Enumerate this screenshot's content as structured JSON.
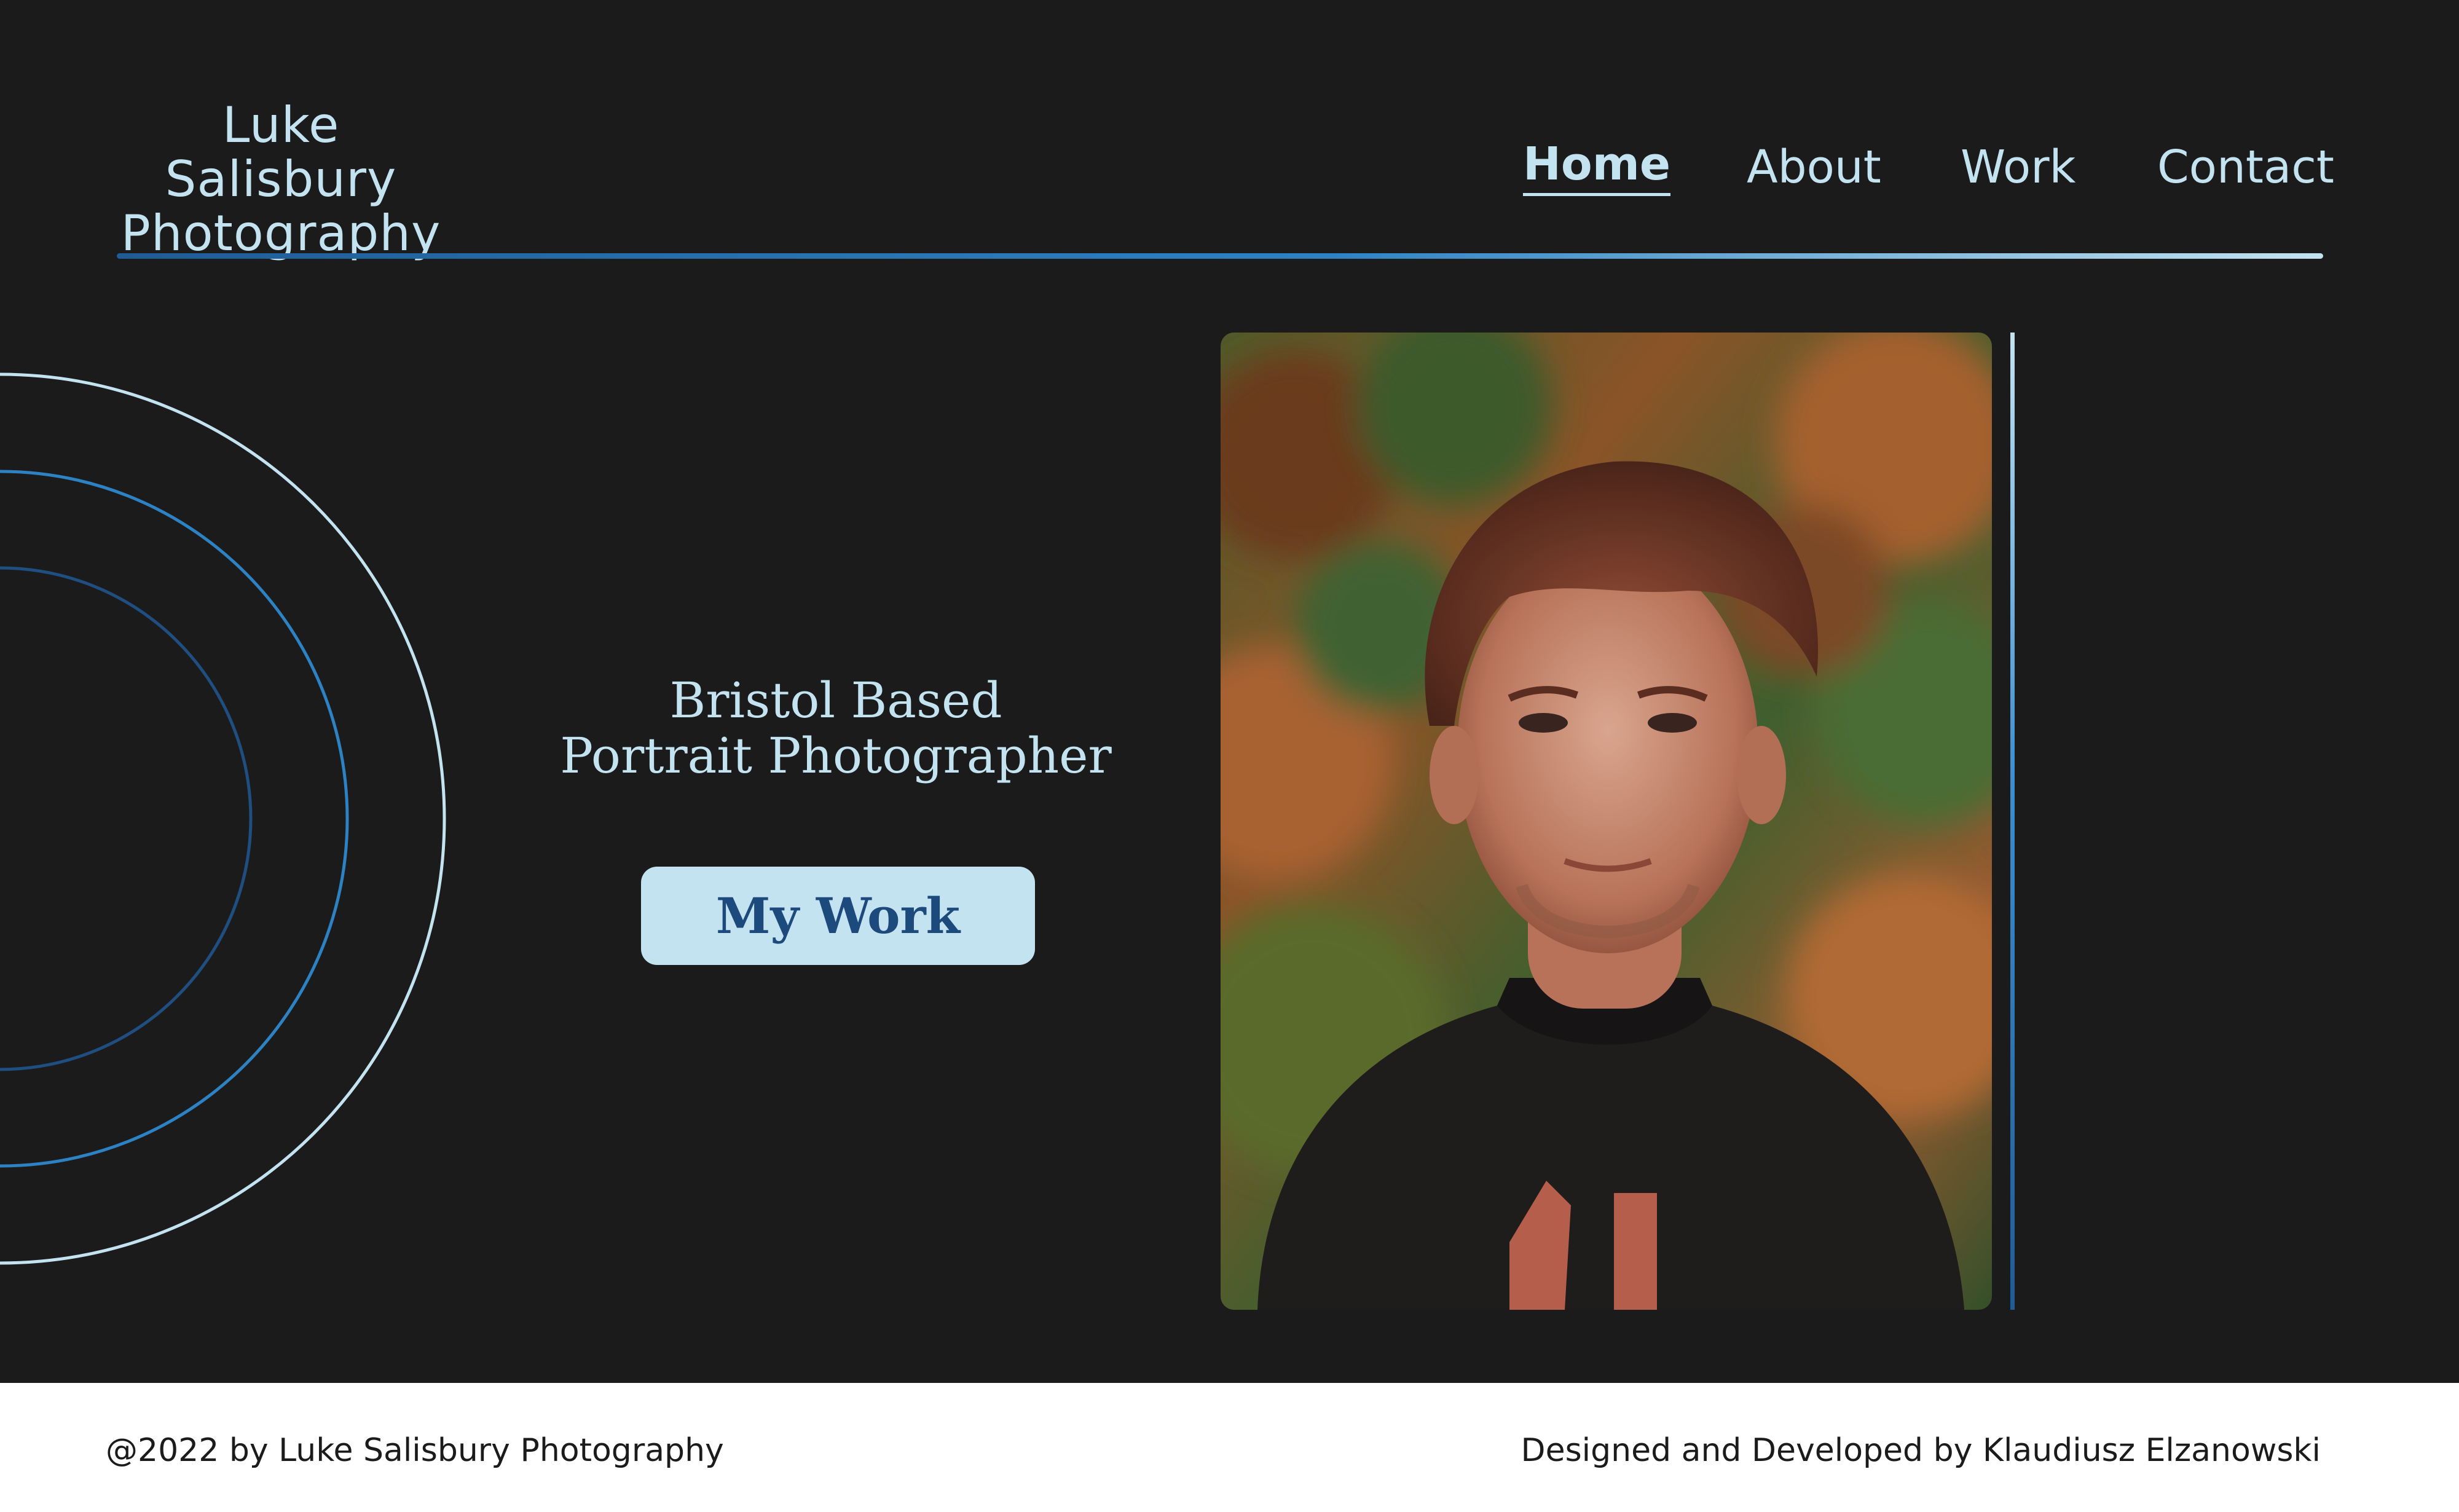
{
  "brand": {
    "line1": "Luke Salisbury",
    "line2": "Photography"
  },
  "nav": {
    "home": "Home",
    "about": "About",
    "work": "Work",
    "contact": "Contact",
    "active": "Home"
  },
  "hero": {
    "tagline_line1": "Bristol Based",
    "tagline_line2": "Portrait Photographer",
    "cta_label": "My Work",
    "portrait_alt": "Portrait photo"
  },
  "footer": {
    "copyright": "@2022 by Luke Salisbury Photography",
    "credit": "Designed and Developed by Klaudiusz Elzanowski"
  },
  "colors": {
    "background": "#1b1b1c",
    "accent_light": "#c4e3f0",
    "accent_blue": "#2d82c4",
    "accent_dark_blue": "#1f5c96",
    "button_text": "#1d4a7c",
    "footer_background": "#ffffff"
  }
}
